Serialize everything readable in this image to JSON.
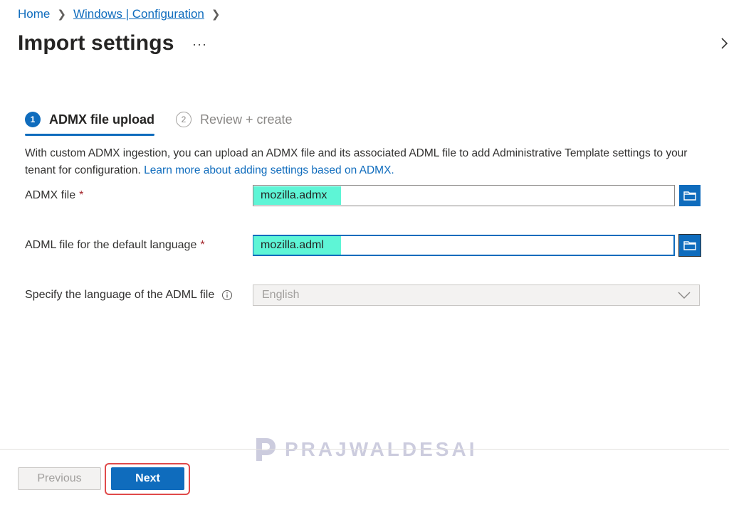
{
  "breadcrumb": {
    "home": "Home",
    "parent": "Windows | Configuration"
  },
  "page": {
    "title": "Import settings",
    "more": "···"
  },
  "tabs": [
    {
      "number": "1",
      "label": "ADMX file upload",
      "active": true
    },
    {
      "number": "2",
      "label": "Review + create",
      "active": false
    }
  ],
  "description": {
    "text": "With custom ADMX ingestion, you can upload an ADMX file and its associated ADML file to add Administrative Template settings to your tenant for configuration. ",
    "link": "Learn more about adding settings based on ADMX."
  },
  "form": {
    "admx": {
      "label": "ADMX file",
      "required_mark": "*",
      "value": "mozilla.admx"
    },
    "adml": {
      "label": "ADML file for the default language",
      "required_mark": "*",
      "value": "mozilla.adml"
    },
    "language": {
      "label": "Specify the language of the ADML file",
      "value": "English"
    }
  },
  "footer": {
    "previous": "Previous",
    "next": "Next"
  },
  "watermark": "PRAJWALDESAI",
  "colors": {
    "accent": "#0f6cbd",
    "highlight_fill": "#5ef5d6",
    "callout_border": "#e04a4a",
    "required": "#a4262c"
  },
  "icons": {
    "collapse": "chevron-right-icon",
    "browse": "folder-icon",
    "info": "info-icon",
    "dropdown": "chevron-down-icon"
  }
}
